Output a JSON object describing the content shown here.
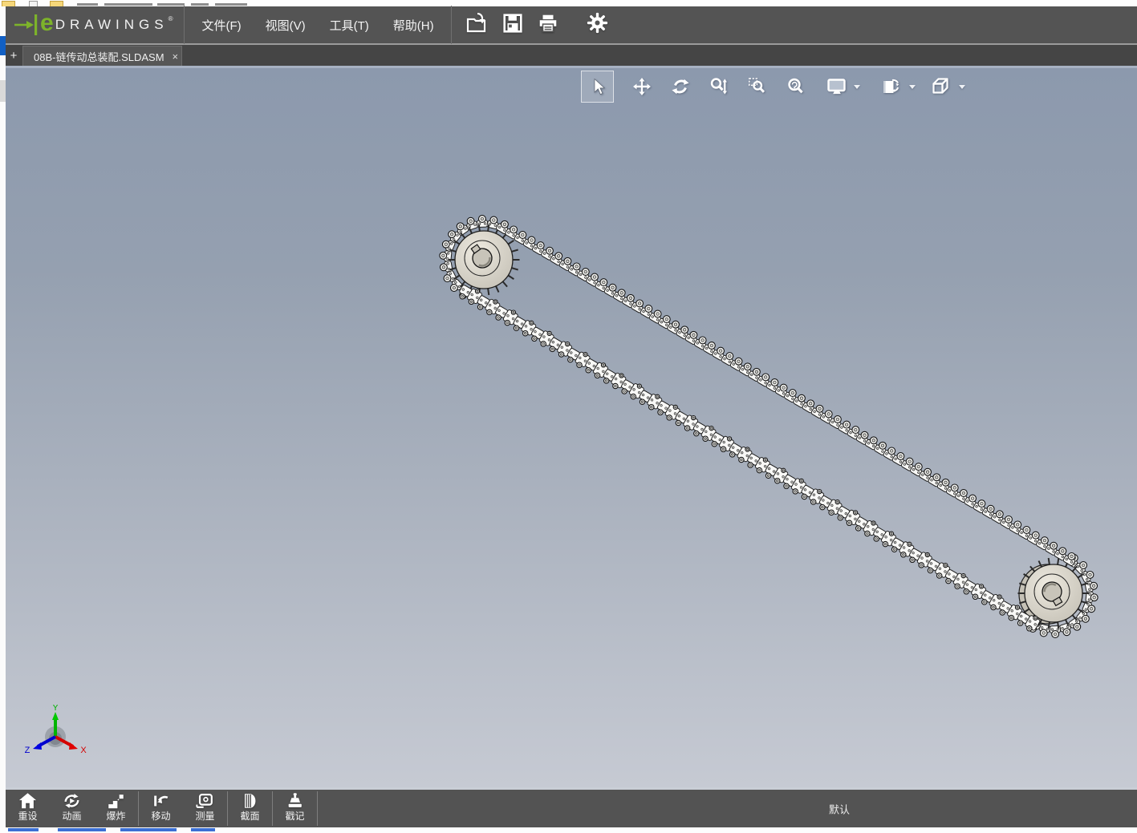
{
  "colors": {
    "bar_bg": "#545454",
    "accent_green": "#7db32a",
    "viewport_top": "#8c99ad",
    "viewport_bottom": "#c6cad3",
    "axis_x": "#d40000",
    "axis_y": "#00b400",
    "axis_z": "#0000cd"
  },
  "brand": {
    "e": "e",
    "name": "DRAWINGS",
    "registered": "®"
  },
  "menubar": {
    "items": [
      {
        "label": "文件(F)"
      },
      {
        "label": "视图(V)"
      },
      {
        "label": "工具(T)"
      },
      {
        "label": "帮助(H)"
      }
    ],
    "icons": [
      {
        "name": "open-icon"
      },
      {
        "name": "save-icon"
      },
      {
        "name": "print-icon"
      },
      {
        "name": "options-gear-icon"
      }
    ]
  },
  "tabs": {
    "new_tab": "+",
    "active": {
      "title": "08B-链传动总装配.SLDASM",
      "close": "×"
    }
  },
  "view_toolbar": {
    "tools": [
      {
        "name": "select",
        "selected": true
      },
      {
        "name": "pan"
      },
      {
        "name": "rotate"
      },
      {
        "name": "zoom-in-out"
      },
      {
        "name": "zoom-area"
      },
      {
        "name": "zoom-fit"
      },
      {
        "name": "display-mode",
        "dropdown": true
      },
      {
        "name": "markup-pages",
        "dropdown": true
      },
      {
        "name": "view-orientation",
        "dropdown": true
      }
    ]
  },
  "viewport": {
    "model": "08B chain drive assembly (two sprockets with roller chain loop)",
    "axis": {
      "x": "X",
      "y": "Y",
      "z": "Z"
    }
  },
  "bottom_toolbar": {
    "buttons": [
      {
        "label": "重设",
        "icon": "home-icon"
      },
      {
        "label": "动画",
        "icon": "animation-icon"
      },
      {
        "label": "爆炸",
        "icon": "explode-icon"
      },
      {
        "label": "移动",
        "icon": "move-icon"
      },
      {
        "label": "测量",
        "icon": "measure-icon"
      },
      {
        "label": "截面",
        "icon": "section-icon"
      },
      {
        "label": "戳记",
        "icon": "stamp-icon"
      }
    ],
    "configuration": "默认"
  }
}
